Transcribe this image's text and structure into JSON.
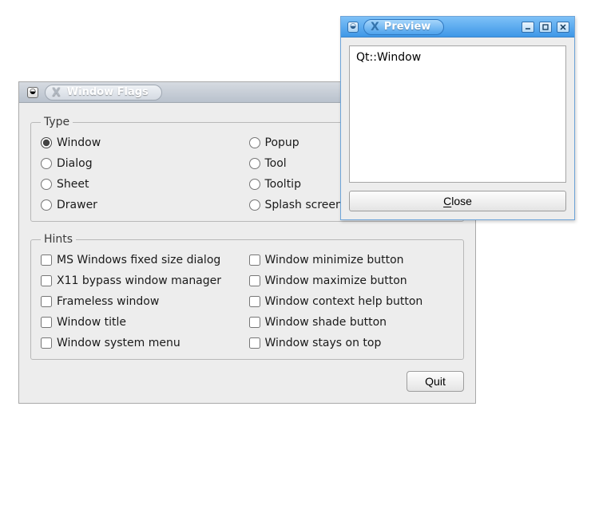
{
  "main": {
    "title": "Window Flags",
    "groups": {
      "type": {
        "legend": "Type",
        "selected": "Window",
        "col1": [
          "Window",
          "Dialog",
          "Sheet",
          "Drawer"
        ],
        "col2": [
          "Popup",
          "Tool",
          "Tooltip",
          "Splash screen"
        ]
      },
      "hints": {
        "legend": "Hints",
        "col1": [
          "MS Windows fixed size dialog",
          "X11 bypass window manager",
          "Frameless window",
          "Window title",
          "Window system menu"
        ],
        "col2": [
          "Window minimize button",
          "Window maximize button",
          "Window context help button",
          "Window shade button",
          "Window stays on top"
        ]
      }
    },
    "quit_label": "Quit"
  },
  "preview": {
    "title": "Preview",
    "content": "Qt::Window",
    "close_label": "Close"
  }
}
